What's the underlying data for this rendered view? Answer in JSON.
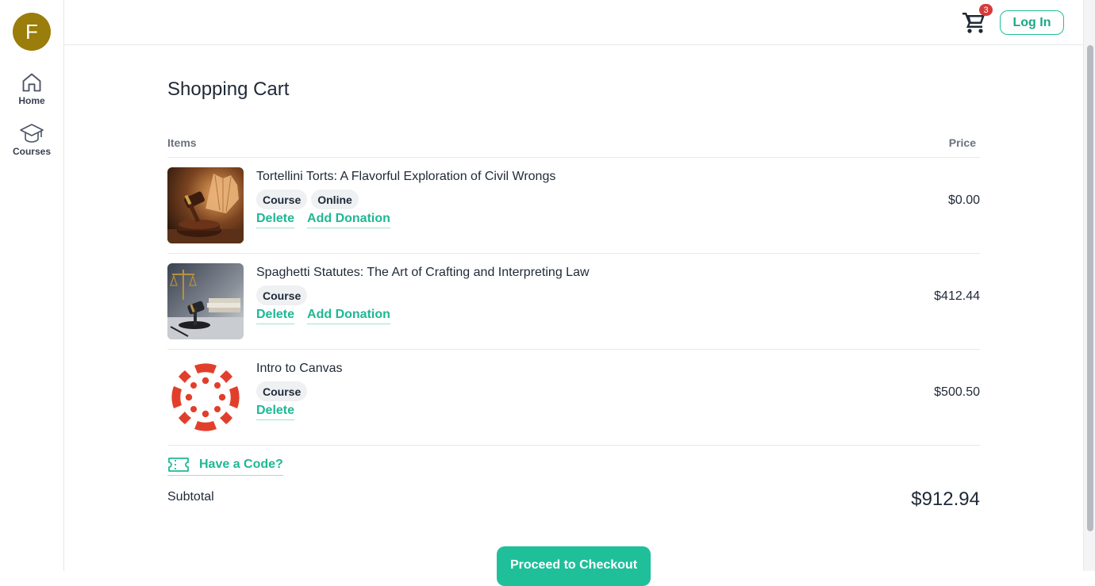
{
  "sidebar": {
    "avatar_initial": "F",
    "avatar_color": "#9a7d0a",
    "items": [
      {
        "label": "Home",
        "icon": "home-icon"
      },
      {
        "label": "Courses",
        "icon": "graduation-cap-icon"
      }
    ]
  },
  "topbar": {
    "cart_icon": "shopping-cart-icon",
    "cart_count": "3",
    "login_label": "Log In"
  },
  "cart": {
    "title": "Shopping Cart",
    "items_header": "Items",
    "price_header": "Price",
    "items": [
      {
        "title": "Tortellini Torts: A Flavorful Exploration of Civil Wrongs",
        "tags": [
          "Course",
          "Online"
        ],
        "price": "$0.00",
        "delete_label": "Delete",
        "donation_label": "Add Donation"
      },
      {
        "title": "Spaghetti Statutes: The Art of Crafting and Interpreting Law",
        "tags": [
          "Course"
        ],
        "price": "$412.44",
        "delete_label": "Delete",
        "donation_label": "Add Donation"
      },
      {
        "title": "Intro to Canvas",
        "tags": [
          "Course"
        ],
        "price": "$500.50",
        "delete_label": "Delete"
      }
    ],
    "code_label": "Have a Code?",
    "subtotal_label": "Subtotal",
    "subtotal_value": "$912.94",
    "checkout_label": "Proceed to Checkout"
  },
  "colors": {
    "accent": "#1fbf9a",
    "badge": "#d63b3b",
    "canvas_logo": "#e13f2b"
  }
}
